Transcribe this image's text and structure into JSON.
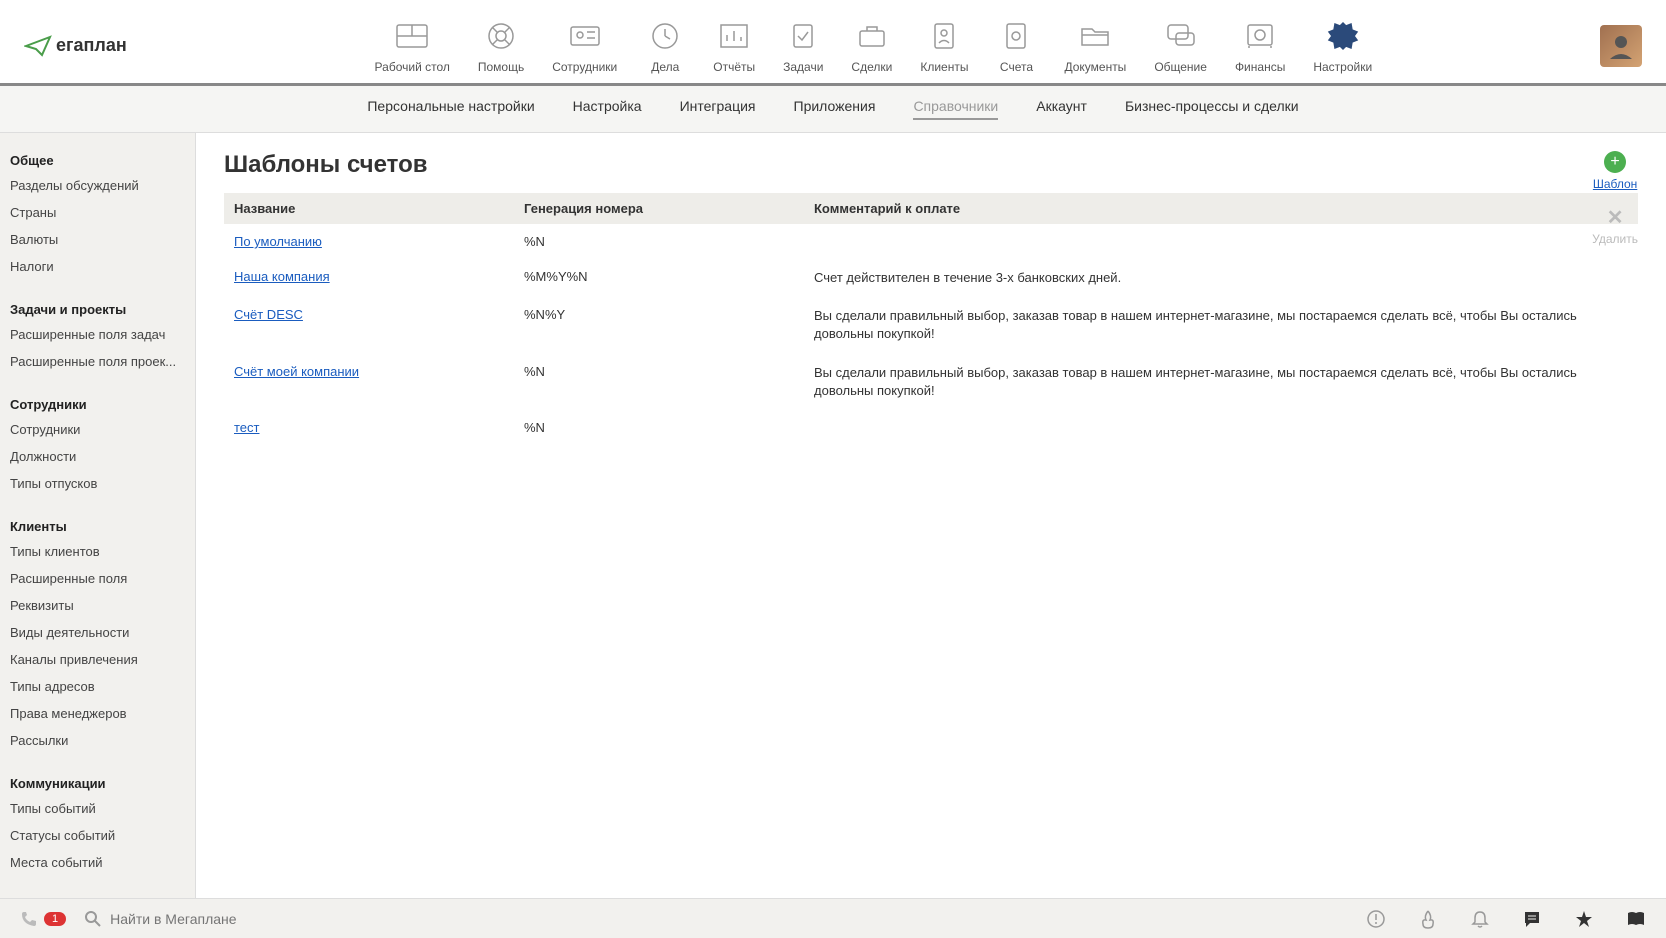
{
  "logo": "егаплан",
  "topnav": [
    {
      "label": "Рабочий стол"
    },
    {
      "label": "Помощь"
    },
    {
      "label": "Сотрудники"
    },
    {
      "label": "Дела"
    },
    {
      "label": "Отчёты"
    },
    {
      "label": "Задачи"
    },
    {
      "label": "Сделки"
    },
    {
      "label": "Клиенты"
    },
    {
      "label": "Счета"
    },
    {
      "label": "Документы"
    },
    {
      "label": "Общение"
    },
    {
      "label": "Финансы"
    },
    {
      "label": "Настройки"
    }
  ],
  "subnav": [
    {
      "label": "Персональные настройки"
    },
    {
      "label": "Настройка"
    },
    {
      "label": "Интеграция"
    },
    {
      "label": "Приложения"
    },
    {
      "label": "Справочники",
      "active": true
    },
    {
      "label": "Аккаунт"
    },
    {
      "label": "Бизнес-процессы и сделки"
    }
  ],
  "sidebar": [
    {
      "heading": "Общее",
      "items": [
        "Разделы обсуждений",
        "Страны",
        "Валюты",
        "Налоги"
      ]
    },
    {
      "heading": "Задачи и проекты",
      "items": [
        "Расширенные поля задач",
        "Расширенные поля проек..."
      ]
    },
    {
      "heading": "Сотрудники",
      "items": [
        "Сотрудники",
        "Должности",
        "Типы отпусков"
      ]
    },
    {
      "heading": "Клиенты",
      "items": [
        "Типы клиентов",
        "Расширенные поля",
        "Реквизиты",
        "Виды деятельности",
        "Каналы привлечения",
        "Типы адресов",
        "Права менеджеров",
        "Рассылки"
      ]
    },
    {
      "heading": "Коммуникации",
      "items": [
        "Типы событий",
        "Статусы событий",
        "Места событий"
      ]
    }
  ],
  "page_title": "Шаблоны счетов",
  "table": {
    "headers": {
      "name": "Название",
      "gen": "Генерация номера",
      "comment": "Комментарий к оплате"
    },
    "rows": [
      {
        "name": "По умолчанию",
        "gen": "%N",
        "comment": ""
      },
      {
        "name": "Наша компания",
        "gen": "%M%Y%N",
        "comment": "Счет действителен в течение 3-х банковских дней."
      },
      {
        "name": "Счёт DESC",
        "gen": "%N%Y",
        "comment": "Вы сделали правильный выбор, заказав товар в нашем интернет-магазине, мы постараемся сделать всё, чтобы Вы остались довольны покупкой!"
      },
      {
        "name": "Счёт моей компании",
        "gen": "%N",
        "comment": "Вы сделали правильный выбор, заказав товар в нашем интернет-магазине, мы постараемся сделать всё, чтобы Вы остались довольны покупкой!"
      },
      {
        "name": "тест",
        "gen": "%N",
        "comment": ""
      }
    ]
  },
  "actions": {
    "add": "Шаблон",
    "delete": "Удалить"
  },
  "bottom": {
    "phone_badge": "1",
    "search_placeholder": "Найти в Мегаплане"
  }
}
